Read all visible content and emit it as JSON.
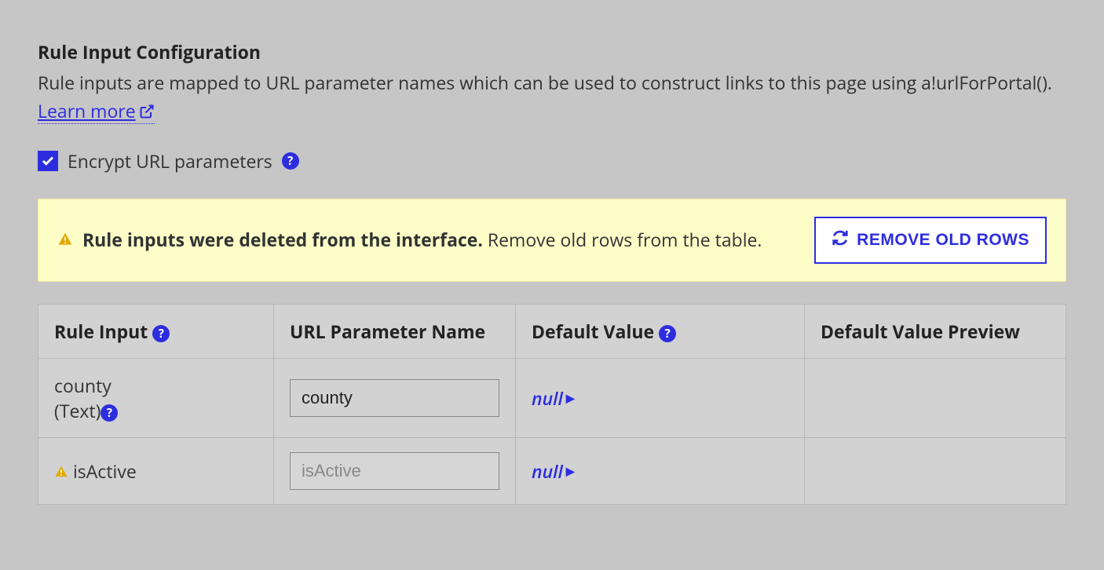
{
  "section": {
    "title": "Rule Input Configuration",
    "description_prefix": "Rule inputs are mapped to URL parameter names which can be used to construct links to this page using a!urlForPortal(). ",
    "learn_more": "Learn more"
  },
  "encrypt": {
    "label": "Encrypt URL parameters",
    "checked": true
  },
  "warning": {
    "strong": "Rule inputs were deleted from the interface.",
    "rest": " Remove old rows from the table.",
    "button_label": "REMOVE OLD ROWS"
  },
  "table": {
    "headers": {
      "rule_input": "Rule Input",
      "url_param": "URL Parameter Name",
      "default_value": "Default Value",
      "default_preview": "Default Value Preview"
    },
    "rows": [
      {
        "warning": false,
        "name": "county",
        "type": "(Text)",
        "url_param": "county",
        "url_param_disabled": false,
        "default_value": "null",
        "preview": ""
      },
      {
        "warning": true,
        "name": "isActive",
        "type": "",
        "url_param": "isActive",
        "url_param_disabled": true,
        "default_value": "null",
        "preview": ""
      }
    ]
  }
}
